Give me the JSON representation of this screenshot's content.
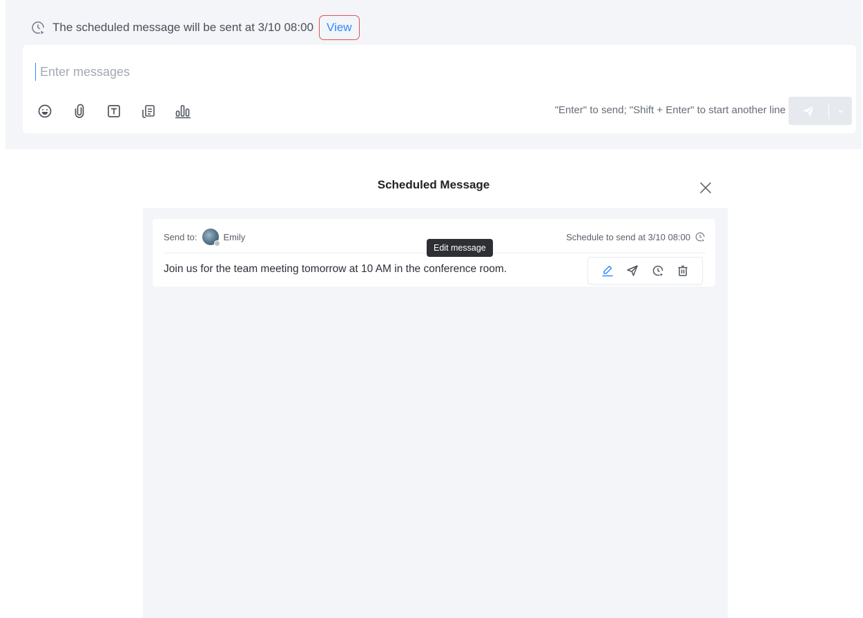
{
  "composer": {
    "schedule_notice": "The scheduled message will be sent at 3/10 08:00",
    "view_link": "View",
    "input_placeholder": "Enter messages",
    "hint": "\"Enter\" to send; \"Shift + Enter\" to start another line",
    "toolbar_icons": [
      "emoji-icon",
      "attachment-icon",
      "text-format-icon",
      "template-icon",
      "poll-icon"
    ]
  },
  "modal": {
    "title": "Scheduled Message",
    "message": {
      "send_to_label": "Send to:",
      "recipient": "Emily",
      "schedule_text": "Schedule to send at 3/10 08:00",
      "body": "Join us for the team meeting tomorrow at 10 AM in the conference room."
    },
    "tooltip": "Edit message",
    "action_icons": [
      "edit-icon",
      "send-now-icon",
      "reschedule-icon",
      "delete-icon"
    ]
  },
  "colors": {
    "accent": "#2f88ff",
    "highlight_border": "#e0524f",
    "panel_bg": "#f3f5f9",
    "tooltip_bg": "#2e2f33"
  }
}
